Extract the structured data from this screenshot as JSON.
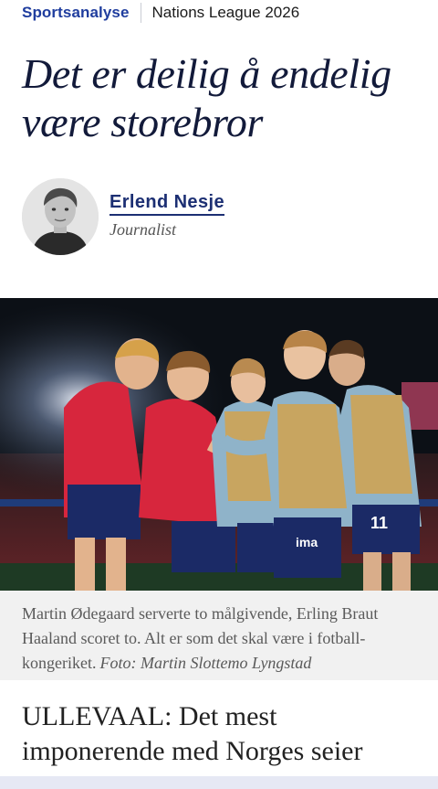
{
  "header": {
    "section": "Sportsanalyse",
    "topic": "Nations League 2026"
  },
  "article": {
    "headline": "Det er deilig å endelig være storebror",
    "author": {
      "name": "Erlend Nesje",
      "role": "Journalist"
    },
    "image": {
      "caption": "Martin Ødegaard serverte to målgivende, Erling Braut Haaland scoret to. Alt er som det skal være i fotball-kongeriket.",
      "credit": "Foto: Martin Slottemo Lyngstad",
      "shirt_number": "11",
      "sponsor": "ima"
    },
    "lead": "ULLEVAAL: Det mest imponerende med Norges seier"
  },
  "colors": {
    "accent": "#1f3d9e",
    "headline": "#121a3a",
    "kit_red": "#d7263d",
    "kit_navy": "#1b2a66",
    "bib_gold": "#c8a560",
    "training_blue": "#8fb3c9"
  }
}
